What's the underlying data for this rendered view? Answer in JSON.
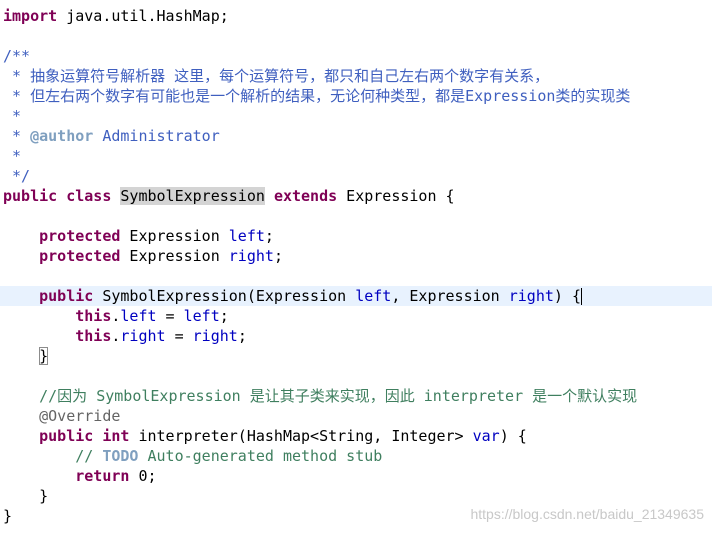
{
  "lines": [
    [
      {
        "t": "import",
        "c": "kw"
      },
      {
        "t": " java.util.HashMap;",
        "c": ""
      }
    ],
    [],
    [
      {
        "t": "/**",
        "c": "doc"
      }
    ],
    [
      {
        "t": " * 抽象运算符号解析器 这里，每个运算符号，都只和自己左右两个数字有关系，",
        "c": "doc"
      }
    ],
    [
      {
        "t": " * 但左右两个数字有可能也是一个解析的结果，无论何种类型，都是Expression类的实现类",
        "c": "doc"
      }
    ],
    [
      {
        "t": " *",
        "c": "doc"
      }
    ],
    [
      {
        "t": " * ",
        "c": "doc"
      },
      {
        "t": "@author",
        "c": "tag"
      },
      {
        "t": " Administrator",
        "c": "doc"
      }
    ],
    [
      {
        "t": " *",
        "c": "doc"
      }
    ],
    [
      {
        "t": " */",
        "c": "doc"
      }
    ],
    [
      {
        "t": "public",
        "c": "kw"
      },
      {
        "t": " ",
        "c": ""
      },
      {
        "t": "class",
        "c": "kw"
      },
      {
        "t": " ",
        "c": ""
      },
      {
        "t": "SymbolExpression",
        "c": "hl"
      },
      {
        "t": " ",
        "c": ""
      },
      {
        "t": "extends",
        "c": "kw"
      },
      {
        "t": " Expression {",
        "c": ""
      }
    ],
    [],
    [
      {
        "t": "    ",
        "c": ""
      },
      {
        "t": "protected",
        "c": "kw"
      },
      {
        "t": " Expression ",
        "c": ""
      },
      {
        "t": "left",
        "c": "field"
      },
      {
        "t": ";",
        "c": ""
      }
    ],
    [
      {
        "t": "    ",
        "c": ""
      },
      {
        "t": "protected",
        "c": "kw"
      },
      {
        "t": " Expression ",
        "c": ""
      },
      {
        "t": "right",
        "c": "field"
      },
      {
        "t": ";",
        "c": ""
      }
    ],
    [],
    [
      {
        "t": "    ",
        "c": ""
      },
      {
        "t": "public",
        "c": "kw"
      },
      {
        "t": " SymbolExpression(Expression ",
        "c": ""
      },
      {
        "t": "left",
        "c": "field"
      },
      {
        "t": ", Expression ",
        "c": ""
      },
      {
        "t": "right",
        "c": "field"
      },
      {
        "t": ") {",
        "c": ""
      }
    ],
    [
      {
        "t": "        ",
        "c": ""
      },
      {
        "t": "this",
        "c": "kw"
      },
      {
        "t": ".",
        "c": ""
      },
      {
        "t": "left",
        "c": "field"
      },
      {
        "t": " = ",
        "c": ""
      },
      {
        "t": "left",
        "c": "field"
      },
      {
        "t": ";",
        "c": ""
      }
    ],
    [
      {
        "t": "        ",
        "c": ""
      },
      {
        "t": "this",
        "c": "kw"
      },
      {
        "t": ".",
        "c": ""
      },
      {
        "t": "right",
        "c": "field"
      },
      {
        "t": " = ",
        "c": ""
      },
      {
        "t": "right",
        "c": "field"
      },
      {
        "t": ";",
        "c": ""
      }
    ],
    [
      {
        "t": "    ",
        "c": ""
      },
      {
        "t": "}",
        "c": "bracket"
      }
    ],
    [],
    [
      {
        "t": "    ",
        "c": ""
      },
      {
        "t": "//因为 SymbolExpression 是让其子类来实现，因此 interpreter 是一个默认实现",
        "c": "cmt"
      }
    ],
    [
      {
        "t": "    ",
        "c": ""
      },
      {
        "t": "@Override",
        "c": "ann"
      }
    ],
    [
      {
        "t": "    ",
        "c": ""
      },
      {
        "t": "public",
        "c": "kw"
      },
      {
        "t": " ",
        "c": ""
      },
      {
        "t": "int",
        "c": "kw"
      },
      {
        "t": " interpreter(HashMap<String, Integer> ",
        "c": ""
      },
      {
        "t": "var",
        "c": "field"
      },
      {
        "t": ") {",
        "c": ""
      }
    ],
    [
      {
        "t": "        ",
        "c": ""
      },
      {
        "t": "// ",
        "c": "cmt"
      },
      {
        "t": "TODO",
        "c": "todo"
      },
      {
        "t": " Auto-generated method stub",
        "c": "cmt"
      }
    ],
    [
      {
        "t": "        ",
        "c": ""
      },
      {
        "t": "return",
        "c": "kw"
      },
      {
        "t": " 0;",
        "c": ""
      }
    ],
    [
      {
        "t": "    }",
        "c": ""
      }
    ],
    [
      {
        "t": "}",
        "c": ""
      }
    ]
  ],
  "current_line_index": 14,
  "watermark": "https://blog.csdn.net/baidu_21349635"
}
